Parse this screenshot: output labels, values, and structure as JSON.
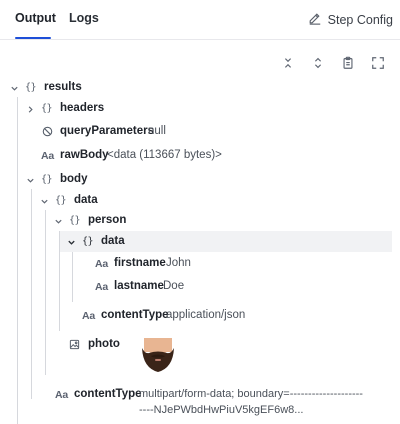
{
  "tabs": [
    {
      "label": "Output",
      "active": true
    },
    {
      "label": "Logs",
      "active": false
    }
  ],
  "step_config_label": "Step Config",
  "toolbar_icons": [
    "collapse-all-icon",
    "expand-all-icon",
    "copy-clipboard-icon",
    "fullscreen-icon"
  ],
  "tree": {
    "results": {
      "key": "results"
    },
    "headers": {
      "key": "headers"
    },
    "queryParameters": {
      "key": "queryParameters",
      "value": "null"
    },
    "rawBody": {
      "key": "rawBody",
      "value": "<data (113667 bytes)>"
    },
    "body": {
      "key": "body"
    },
    "data": {
      "key": "data"
    },
    "person": {
      "key": "person"
    },
    "person_data": {
      "key": "data"
    },
    "firstname": {
      "key": "firstname",
      "value": "John"
    },
    "lastname": {
      "key": "lastname",
      "value": "Doe"
    },
    "contentType_inner": {
      "key": "contentType",
      "value": "application/json"
    },
    "photo": {
      "key": "photo"
    },
    "contentType_outer": {
      "key": "contentType",
      "value_line1": "multipart/form-data; boundary=--------------------",
      "value_line2": "----NJePWbdHwPiuV5kgEF6w8..."
    }
  },
  "icon_labels": {
    "object": "{}",
    "string": "Aa"
  },
  "colors": {
    "accent": "#1e4fd8",
    "selected_row": "#f1f2f4",
    "guide": "#d6d8dd"
  }
}
